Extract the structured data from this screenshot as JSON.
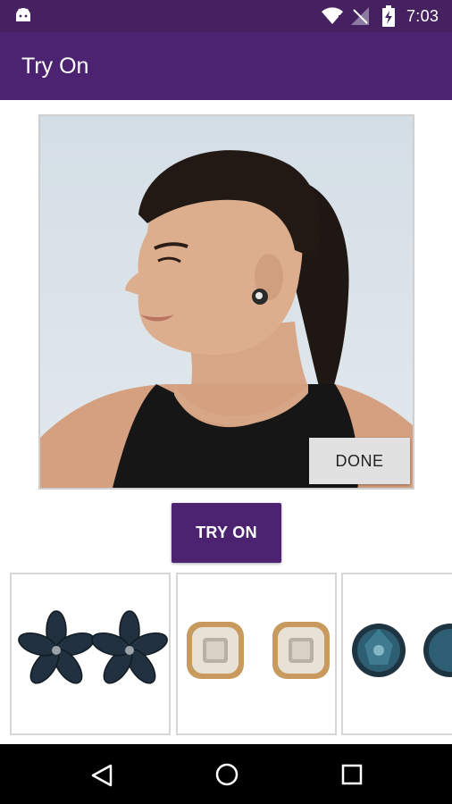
{
  "status_bar": {
    "time": "7:03",
    "icons": [
      "android-icon",
      "wifi-icon",
      "no-signal-icon",
      "battery-charging-icon"
    ]
  },
  "app_bar": {
    "title": "Try On"
  },
  "preview": {
    "image": "woman-profile-wearing-earring",
    "done_label": "DONE"
  },
  "try_on_label": "TRY ON",
  "products": [
    {
      "icon": "flower-earrings-icon",
      "colors": [
        "#1e2d3a",
        "#2f4a60"
      ]
    },
    {
      "icon": "square-gold-earrings-icon",
      "colors": [
        "#c99a5d",
        "#d9d2c4"
      ]
    },
    {
      "icon": "round-blue-stud-icon",
      "colors": [
        "#2d5e73",
        "#1f3442"
      ]
    }
  ],
  "nav": {
    "back": "back-icon",
    "home": "home-icon",
    "recents": "recents-icon"
  },
  "colors": {
    "primary": "#4b2371",
    "status": "#45215f"
  }
}
